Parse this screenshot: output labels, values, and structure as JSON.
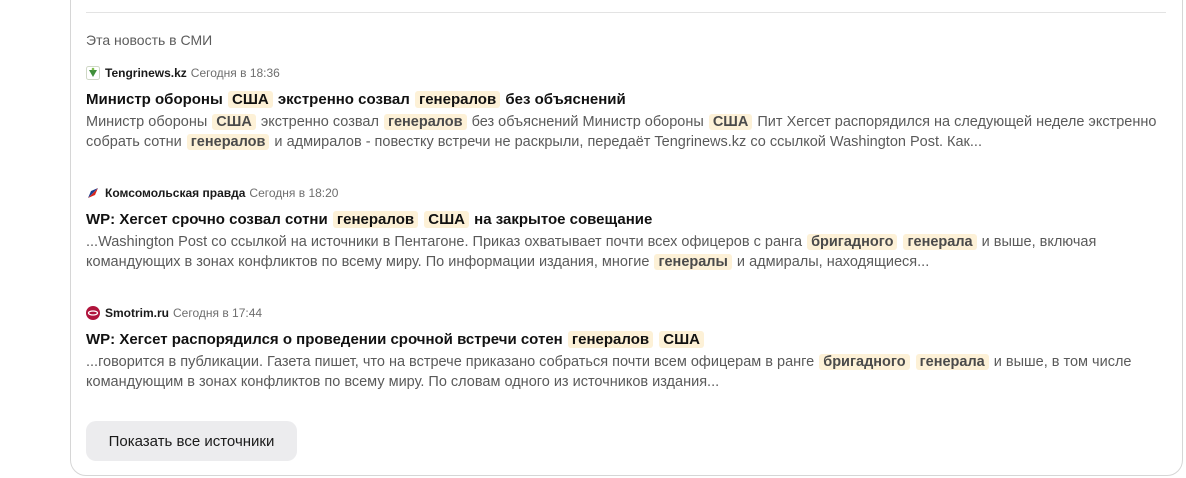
{
  "section": {
    "title": "Эта новость в СМИ"
  },
  "items": [
    {
      "source": "Tengrinews.kz",
      "time": "Сегодня в 18:36",
      "favicon": "tengrinews-icon",
      "headline": [
        {
          "t": "Министр обороны "
        },
        {
          "t": "США",
          "hl": true
        },
        {
          "t": " экстренно созвал "
        },
        {
          "t": "генералов",
          "hl": true
        },
        {
          "t": " без объяснений"
        }
      ],
      "snippet": [
        {
          "t": "Министр обороны "
        },
        {
          "t": "США",
          "hl": true
        },
        {
          "t": " экстренно созвал "
        },
        {
          "t": "генералов",
          "hl": true
        },
        {
          "t": " без объяснений Министр обороны "
        },
        {
          "t": "США",
          "hl": true
        },
        {
          "t": " Пит Хегсет распорядился на следующей неделе экстренно собрать сотни "
        },
        {
          "t": "генералов",
          "hl": true
        },
        {
          "t": " и адмиралов - повестку встречи не раскрыли, передаёт Tengrinews.kz со ссылкой Washington Post. Как..."
        }
      ]
    },
    {
      "source": "Комсомольская правда",
      "time": "Сегодня в 18:20",
      "favicon": "kp-icon",
      "headline": [
        {
          "t": "WP: Хегсет срочно созвал сотни "
        },
        {
          "t": "генералов",
          "hl": true
        },
        {
          "t": " "
        },
        {
          "t": "США",
          "hl": true
        },
        {
          "t": " на закрытое совещание"
        }
      ],
      "snippet": [
        {
          "t": "...Washington Post со ссылкой на источники в Пентагоне. Приказ охватывает почти всех офицеров с ранга "
        },
        {
          "t": "бригадного",
          "hl": true
        },
        {
          "t": " "
        },
        {
          "t": "генерала",
          "hl": true
        },
        {
          "t": " и выше, включая командующих в зонах конфликтов по всему миру. По информации издания, многие "
        },
        {
          "t": "генералы",
          "hl": true
        },
        {
          "t": " и адмиралы, находящиеся..."
        }
      ]
    },
    {
      "source": "Smotrim.ru",
      "time": "Сегодня в 17:44",
      "favicon": "smotrim-icon",
      "headline": [
        {
          "t": "WP: Хегсет распорядился о проведении срочной встречи сотен "
        },
        {
          "t": "генералов",
          "hl": true
        },
        {
          "t": " "
        },
        {
          "t": "США",
          "hl": true
        }
      ],
      "snippet": [
        {
          "t": "...говорится в публикации. Газета пишет, что на встрече приказано собраться почти всем офицерам в ранге "
        },
        {
          "t": "бригадного",
          "hl": true
        },
        {
          "t": " "
        },
        {
          "t": "генерала",
          "hl": true
        },
        {
          "t": " и выше, в том числе командующим в зонах конфликтов по всему миру. По словам одного из источников издания..."
        }
      ]
    }
  ],
  "show_all_label": "Показать все источники",
  "colors": {
    "highlight": "#fdf1d7",
    "button_bg": "#ececee",
    "smotrim": "#b0143c",
    "kp": "#d9261c"
  }
}
